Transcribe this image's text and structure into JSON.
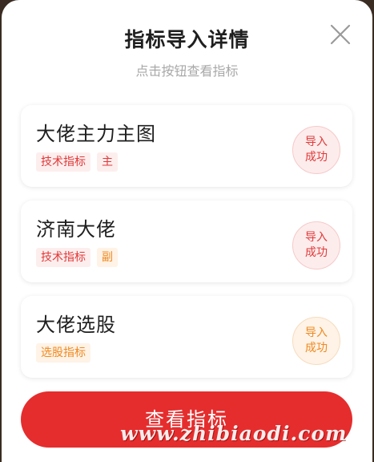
{
  "modal": {
    "title": "指标导入详情",
    "subtitle": "点击按钮查看指标"
  },
  "items": [
    {
      "name": "大佬主力主图",
      "tags": [
        {
          "label": "技术指标",
          "color": "red"
        },
        {
          "label": "主",
          "color": "red"
        }
      ],
      "status": [
        "导入",
        "成功"
      ],
      "status_color": "red"
    },
    {
      "name": "济南大佬",
      "tags": [
        {
          "label": "技术指标",
          "color": "red"
        },
        {
          "label": "副",
          "color": "orange"
        }
      ],
      "status": [
        "导入",
        "成功"
      ],
      "status_color": "red"
    },
    {
      "name": "大佬选股",
      "tags": [
        {
          "label": "选股指标",
          "color": "orange"
        }
      ],
      "status": [
        "导入",
        "成功"
      ],
      "status_color": "orange"
    }
  ],
  "button": {
    "label": "查看指标"
  },
  "watermark": "www.zhibiaodi.com",
  "colors": {
    "accent_red": "#e52d2d",
    "tag_red": "#e03a3a",
    "tag_orange": "#ef8a22"
  },
  "icons": {
    "close": "close-icon"
  }
}
